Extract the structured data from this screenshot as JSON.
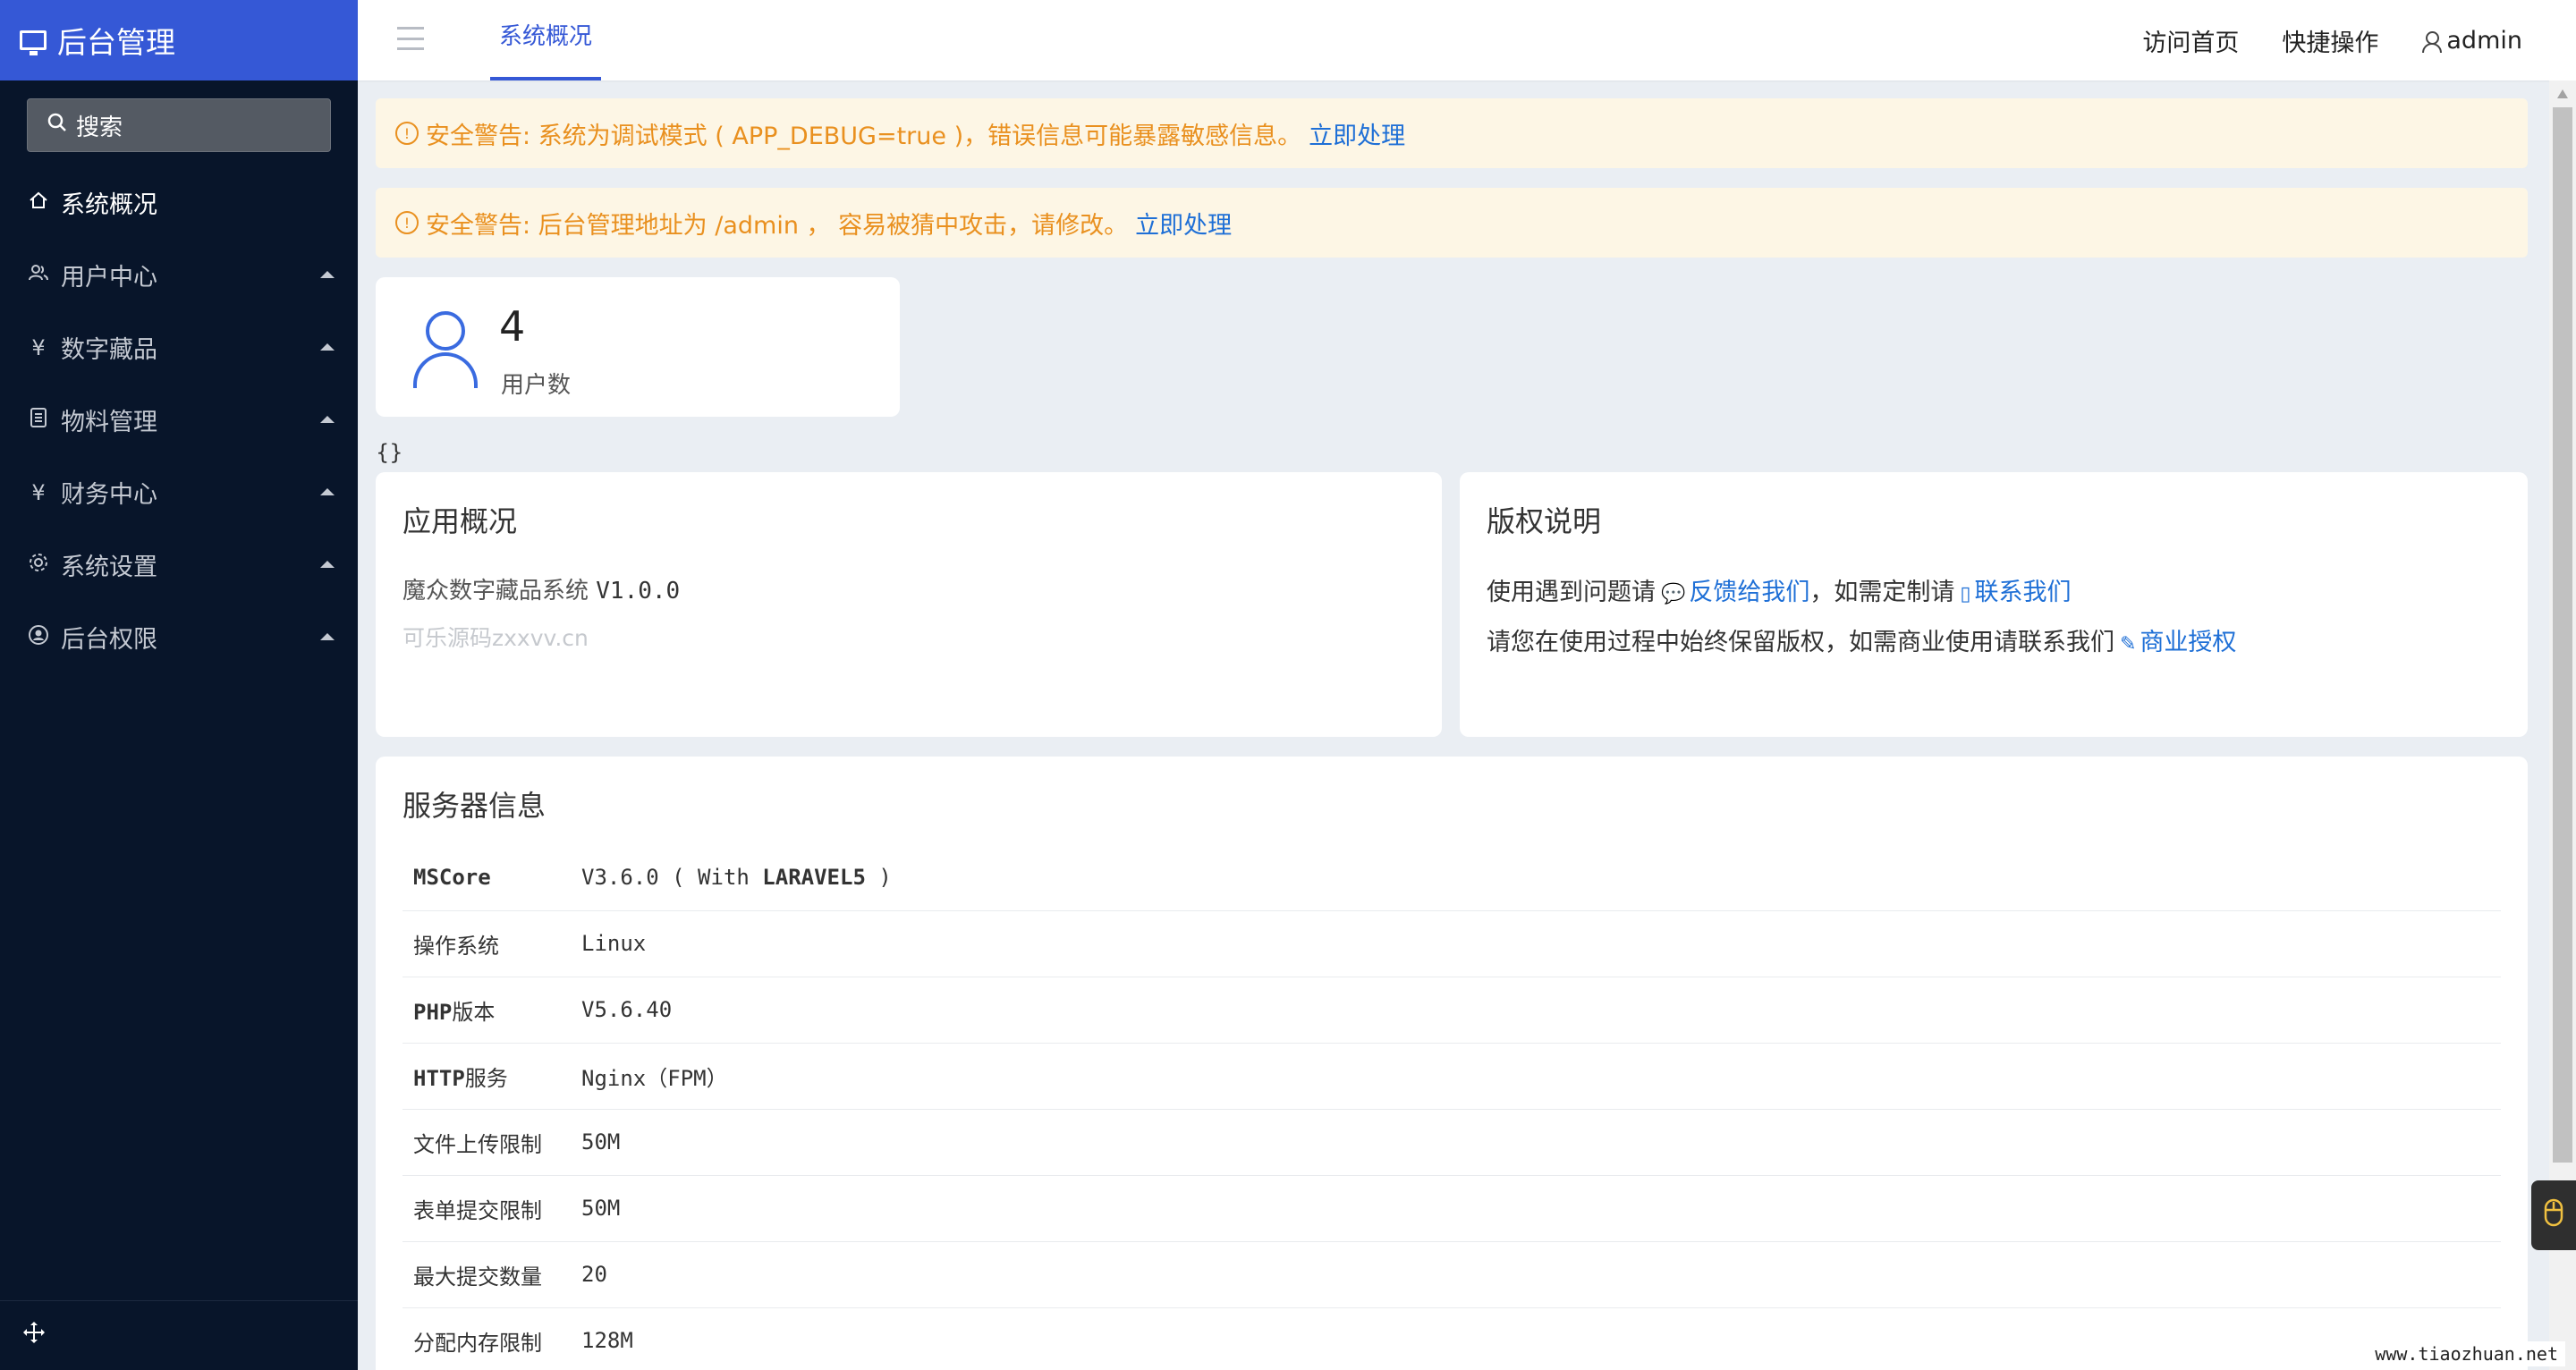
{
  "brand": {
    "title": "后台管理",
    "icon": "monitor-icon"
  },
  "sidebar": {
    "search_label": "搜索",
    "items": [
      {
        "label": "系统概况",
        "icon": "home-icon"
      },
      {
        "label": "用户中心",
        "icon": "users-icon"
      },
      {
        "label": "数字藏品",
        "icon": "yen-icon"
      },
      {
        "label": "物料管理",
        "icon": "document-list-icon"
      },
      {
        "label": "财务中心",
        "icon": "yen-icon"
      },
      {
        "label": "系统设置",
        "icon": "gear-icon"
      },
      {
        "label": "后台权限",
        "icon": "user-circle-icon"
      }
    ]
  },
  "header": {
    "tab": "系统概况",
    "links": {
      "home": "访问首页",
      "quick": "快捷操作",
      "user": "admin"
    }
  },
  "alerts": [
    {
      "text": "安全警告: 系统为调试模式 ( APP_DEBUG=true )，错误信息可能暴露敏感信息。",
      "link": "立即处理"
    },
    {
      "text": "安全警告: 后台管理地址为 /admin ， 容易被猜中攻击，请修改。",
      "link": "立即处理"
    }
  ],
  "stat": {
    "value": "4",
    "label": "用户数"
  },
  "braces": "{}",
  "app_overview": {
    "title": "应用概况",
    "system_name": "魔众数字藏品系统",
    "version": "V1.0.0",
    "site": "可乐源码zxxvv.cn"
  },
  "copyright": {
    "title": "版权说明",
    "line1_pre": "使用遇到问题请",
    "feedback": "反馈给我们",
    "line1_mid": "，如需定制请",
    "contact": "联系我们",
    "line2_pre": "请您在使用过程中始终保留版权，如需商业使用请联系我们",
    "license": "商业授权"
  },
  "server": {
    "title": "服务器信息",
    "rows": [
      {
        "key_bold": "MSCore",
        "key": "",
        "value_pre": "V3.6.0 ( With ",
        "value_bold": "LARAVEL5",
        "value_post": " )"
      },
      {
        "key_bold": "",
        "key": "操作系统",
        "value_pre": "Linux",
        "value_bold": "",
        "value_post": ""
      },
      {
        "key_bold": "PHP",
        "key": "版本",
        "value_pre": "V5.6.40",
        "value_bold": "",
        "value_post": ""
      },
      {
        "key_bold": "HTTP",
        "key": "服务",
        "value_pre": "Nginx（FPM）",
        "value_bold": "",
        "value_post": ""
      },
      {
        "key_bold": "",
        "key": "文件上传限制",
        "value_pre": "50M",
        "value_bold": "",
        "value_post": ""
      },
      {
        "key_bold": "",
        "key": "表单提交限制",
        "value_pre": "50M",
        "value_bold": "",
        "value_post": ""
      },
      {
        "key_bold": "",
        "key": "最大提交数量",
        "value_pre": "20",
        "value_bold": "",
        "value_post": ""
      },
      {
        "key_bold": "",
        "key": "分配内存限制",
        "value_pre": "128M",
        "value_bold": "",
        "value_post": ""
      }
    ]
  },
  "watermark": "www.tiaozhuan.net",
  "colors": {
    "brand": "#3558d6",
    "sidebar": "#08152a",
    "warning": "#e9901f",
    "link": "#1e6fd6"
  }
}
